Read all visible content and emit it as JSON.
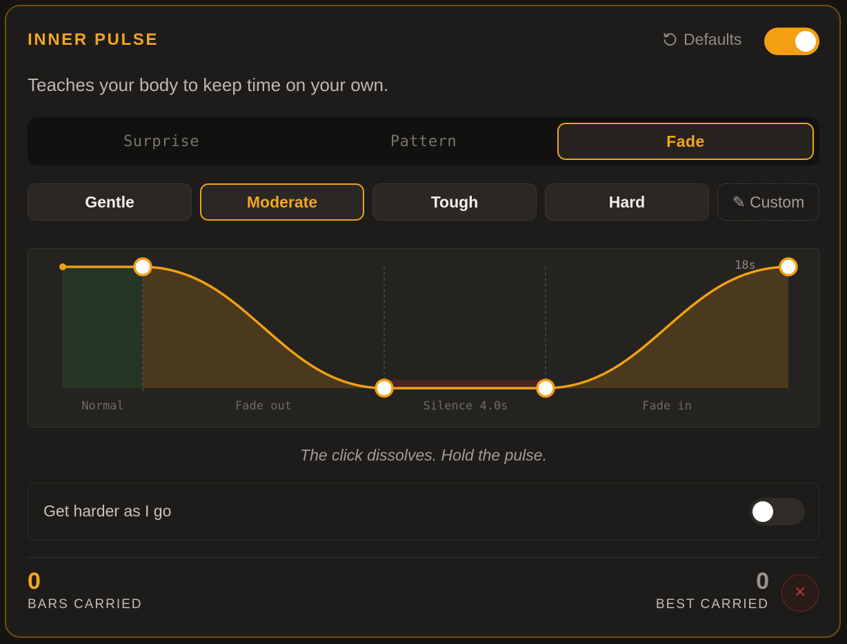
{
  "header": {
    "title": "INNER PULSE",
    "defaults_label": "Defaults",
    "enabled": true
  },
  "subtitle": "Teaches your body to keep time on your own.",
  "modes": {
    "items": [
      "Surprise",
      "Pattern",
      "Fade"
    ],
    "selected": "Fade"
  },
  "difficulty": {
    "items": [
      "Gentle",
      "Moderate",
      "Tough",
      "Hard"
    ],
    "custom_label": "Custom",
    "selected": "Moderate"
  },
  "chart_data": {
    "type": "area",
    "segments": [
      "Normal",
      "Fade out",
      "Silence 4.0s",
      "Fade in"
    ],
    "duration_label": "18s"
  },
  "caption": "The click dissolves. Hold the pulse.",
  "harder": {
    "label": "Get harder as I go",
    "enabled": false
  },
  "stats": {
    "bars_carried": "0",
    "bars_carried_label": "BARS CARRIED",
    "best_carried": "0",
    "best_carried_label": "BEST CARRIED"
  },
  "colors": {
    "accent": "#f2a51e",
    "normal_zone": "#253626",
    "fade_zone": "#4a391c",
    "silence_zone": "#4a2424"
  }
}
